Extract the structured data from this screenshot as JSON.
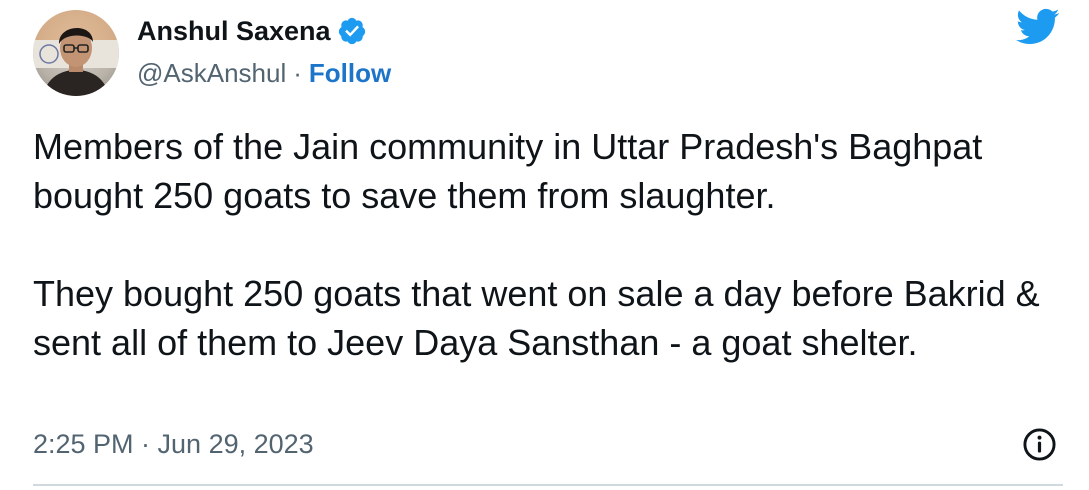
{
  "author": {
    "display_name": "Anshul Saxena",
    "handle": "@AskAnshul",
    "separator": "·",
    "follow_label": "Follow",
    "verified": true,
    "avatar_icon": "profile-photo"
  },
  "tweet": {
    "paragraphs": [
      "Members of the Jain community in Uttar Pradesh's Baghpat bought 250 goats to save them from slaughter.",
      "They bought 250 goats that went on sale a day before Bakrid & sent all of them to Jeev Daya Sansthan - a goat shelter."
    ],
    "timestamp": "2:25 PM · Jun 29, 2023"
  },
  "icons": {
    "logo": "twitter-bird-icon",
    "verified": "verified-badge-icon",
    "info": "info-icon"
  },
  "colors": {
    "brand": "#1d9bf0",
    "follow": "#1d75c9",
    "text": "#0f1419",
    "muted": "#536471",
    "divider": "#cfd9de"
  }
}
